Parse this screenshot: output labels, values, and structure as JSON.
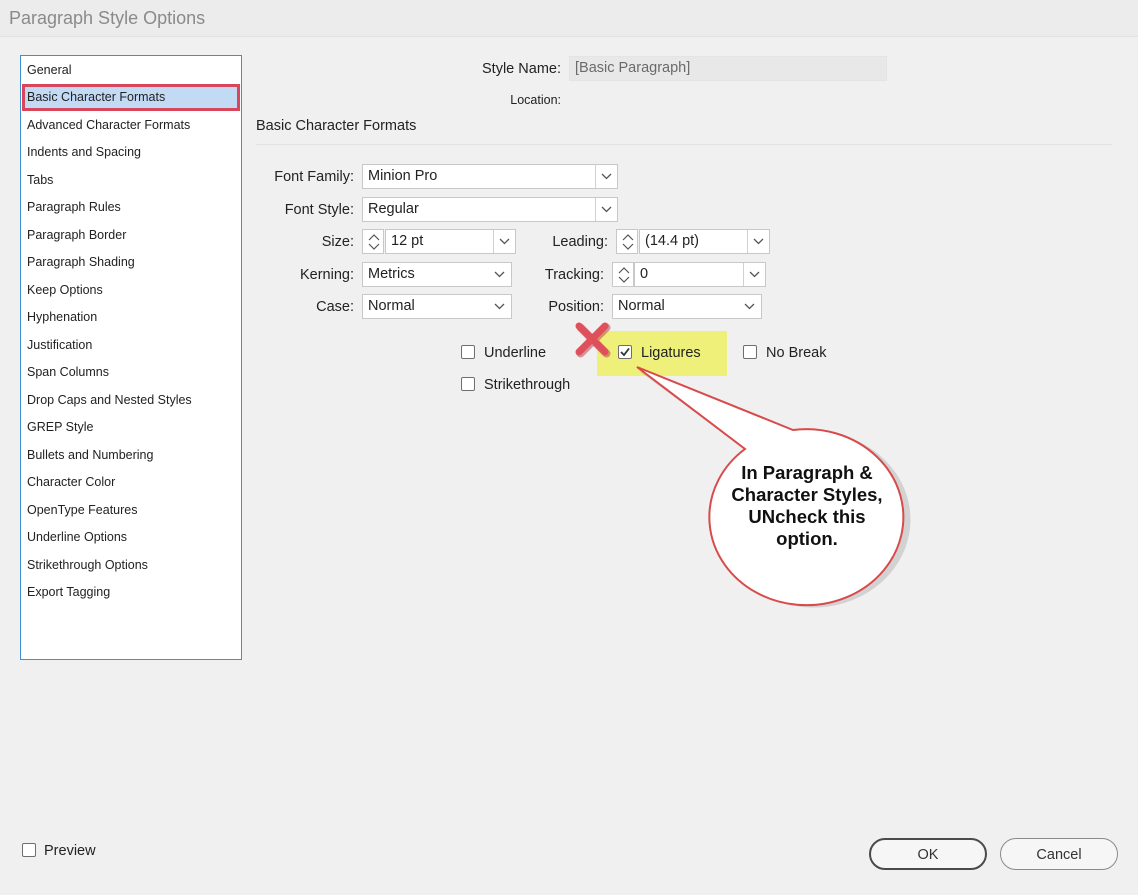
{
  "window": {
    "title": "Paragraph Style Options"
  },
  "sidebar": {
    "items": [
      {
        "label": "General"
      },
      {
        "label": "Basic Character Formats",
        "selected": true
      },
      {
        "label": "Advanced Character Formats"
      },
      {
        "label": "Indents and Spacing"
      },
      {
        "label": "Tabs"
      },
      {
        "label": "Paragraph Rules"
      },
      {
        "label": "Paragraph Border"
      },
      {
        "label": "Paragraph Shading"
      },
      {
        "label": "Keep Options"
      },
      {
        "label": "Hyphenation"
      },
      {
        "label": "Justification"
      },
      {
        "label": "Span Columns"
      },
      {
        "label": "Drop Caps and Nested Styles"
      },
      {
        "label": "GREP Style"
      },
      {
        "label": "Bullets and Numbering"
      },
      {
        "label": "Character Color"
      },
      {
        "label": "OpenType Features"
      },
      {
        "label": "Underline Options"
      },
      {
        "label": "Strikethrough Options"
      },
      {
        "label": "Export Tagging"
      }
    ]
  },
  "header": {
    "style_name_label": "Style Name:",
    "style_name_value": "[Basic Paragraph]",
    "location_label": "Location:",
    "section_title": "Basic Character Formats"
  },
  "form": {
    "font_family_label": "Font Family:",
    "font_family_value": "Minion Pro",
    "font_style_label": "Font Style:",
    "font_style_value": "Regular",
    "size_label": "Size:",
    "size_value": "12 pt",
    "leading_label": "Leading:",
    "leading_value": "(14.4 pt)",
    "kerning_label": "Kerning:",
    "kerning_value": "Metrics",
    "tracking_label": "Tracking:",
    "tracking_value": "0",
    "case_label": "Case:",
    "case_value": "Normal",
    "position_label": "Position:",
    "position_value": "Normal"
  },
  "checkboxes": {
    "underline": {
      "label": "Underline",
      "checked": false
    },
    "ligatures": {
      "label": "Ligatures",
      "checked": true
    },
    "no_break": {
      "label": "No Break",
      "checked": false
    },
    "strikethrough": {
      "label": "Strikethrough",
      "checked": false
    }
  },
  "annotation": {
    "callout_text": "In Paragraph & Character Styles, UNcheck this option.",
    "highlight_color": "#eff07a",
    "callout_border_color": "#d94a4a",
    "x_mark_color": "#e0505a"
  },
  "footer": {
    "preview_label": "Preview",
    "preview_checked": false,
    "ok_label": "OK",
    "cancel_label": "Cancel"
  },
  "colors": {
    "selected_bg": "#c3daf4",
    "selected_border": "#d8465b",
    "sidebar_border": "#3d8fd6"
  }
}
